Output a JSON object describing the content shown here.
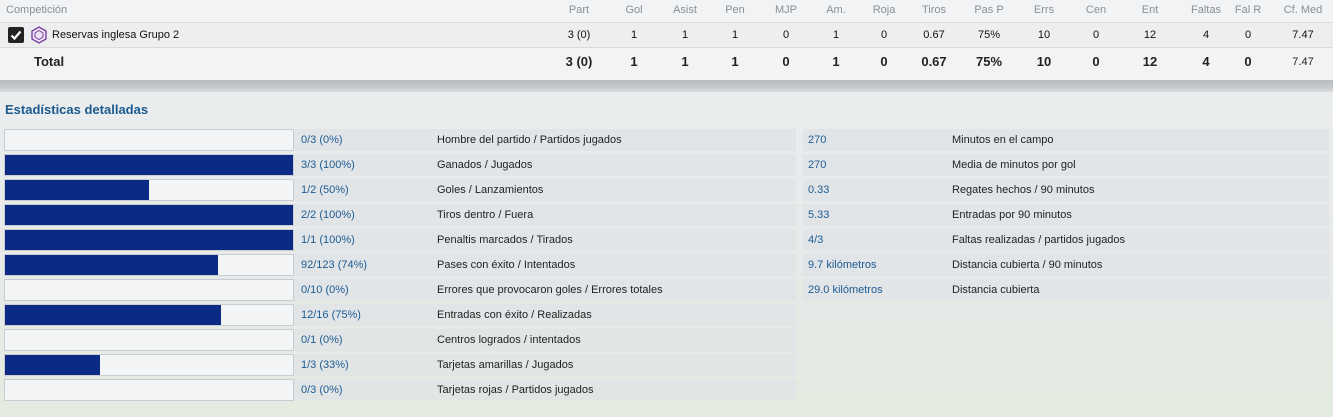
{
  "table": {
    "competition_header": "Competición",
    "columns": [
      {
        "key": "part",
        "label": "Part"
      },
      {
        "key": "gol",
        "label": "Gol"
      },
      {
        "key": "asist",
        "label": "Asist"
      },
      {
        "key": "pen",
        "label": "Pen"
      },
      {
        "key": "mjp",
        "label": "MJP"
      },
      {
        "key": "am",
        "label": "Am."
      },
      {
        "key": "roja",
        "label": "Roja"
      },
      {
        "key": "tiros",
        "label": "Tiros"
      },
      {
        "key": "pasp",
        "label": "Pas P"
      },
      {
        "key": "errs",
        "label": "Errs"
      },
      {
        "key": "cen",
        "label": "Cen"
      },
      {
        "key": "ent",
        "label": "Ent"
      },
      {
        "key": "faltas",
        "label": "Faltas"
      },
      {
        "key": "falr",
        "label": "Fal R"
      },
      {
        "key": "cfmed",
        "label": "Cf. Med"
      }
    ],
    "row": {
      "checked": true,
      "icon": "competition-badge-icon",
      "competition": "Reservas inglesa Grupo 2",
      "values": [
        "3 (0)",
        "1",
        "1",
        "1",
        "0",
        "1",
        "0",
        "0.67",
        "75%",
        "10",
        "0",
        "12",
        "4",
        "0",
        "7.47"
      ]
    },
    "total": {
      "label": "Total",
      "values": [
        "3 (0)",
        "1",
        "1",
        "1",
        "0",
        "1",
        "0",
        "0.67",
        "75%",
        "10",
        "0",
        "12",
        "4",
        "0",
        "7.47"
      ]
    }
  },
  "detailed": {
    "title": "Estadísticas detalladas",
    "left": [
      {
        "value": "0/3 (0%)",
        "label": "Hombre del partido / Partidos jugados",
        "fraction": 0
      },
      {
        "value": "3/3 (100%)",
        "label": "Ganados / Jugados",
        "fraction": 1
      },
      {
        "value": "1/2 (50%)",
        "label": "Goles / Lanzamientos",
        "fraction": 0.5
      },
      {
        "value": "2/2 (100%)",
        "label": "Tiros dentro / Fuera",
        "fraction": 1
      },
      {
        "value": "1/1 (100%)",
        "label": "Penaltis marcados / Tirados",
        "fraction": 1
      },
      {
        "value": "92/123 (74%)",
        "label": "Pases con éxito / Intentados",
        "fraction": 0.74
      },
      {
        "value": "0/10 (0%)",
        "label": "Errores que provocaron goles / Errores totales",
        "fraction": 0
      },
      {
        "value": "12/16 (75%)",
        "label": "Entradas con éxito / Realizadas",
        "fraction": 0.75
      },
      {
        "value": "0/1 (0%)",
        "label": "Centros logrados / intentados",
        "fraction": 0
      },
      {
        "value": "1/3 (33%)",
        "label": "Tarjetas amarillas / Jugados",
        "fraction": 0.33
      },
      {
        "value": "0/3 (0%)",
        "label": "Tarjetas rojas / Partidos jugados",
        "fraction": 0
      }
    ],
    "right": [
      {
        "value": "270",
        "label": "Minutos en el campo"
      },
      {
        "value": "270",
        "label": "Media de minutos por gol"
      },
      {
        "value": "0.33",
        "label": "Regates hechos / 90 minutos"
      },
      {
        "value": "5.33",
        "label": "Entradas por 90 minutos"
      },
      {
        "value": "4/3",
        "label": "Faltas realizadas / partidos jugados"
      },
      {
        "value": "9.7 kilómetros",
        "label": "Distancia cubierta / 90 minutos"
      },
      {
        "value": "29.0 kilómetros",
        "label": "Distancia cubierta"
      }
    ]
  },
  "colors": {
    "bar_fill": "#0a2a86",
    "value_text": "#1d5b93",
    "section_title": "#1c5a8e"
  }
}
